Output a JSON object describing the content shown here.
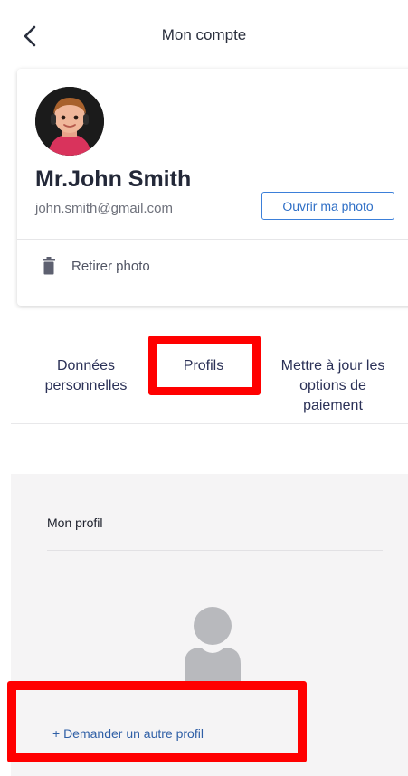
{
  "header": {
    "title": "Mon compte",
    "back_icon": "chevron-left-icon"
  },
  "account_card": {
    "name": "Mr.John Smith",
    "email": "john.smith@gmail.com",
    "open_photo_label": "Ouvrir ma photo",
    "remove_photo_label": "Retirer photo",
    "remove_icon": "trash-icon"
  },
  "tabs": {
    "personal_data": "Données personnelles",
    "profiles": "Profils",
    "payment_options": "Mettre à jour les options de paiement",
    "highlighted": "Profils"
  },
  "profile_panel": {
    "title": "Mon profil",
    "placeholder_icon": "user-placeholder-icon",
    "request_link": "+ Demander un autre profil"
  },
  "colors": {
    "accent": "#2f6fc6",
    "tab_text": "#2b3157",
    "highlight": "#ff0000",
    "panel_bg": "#f5f4f5"
  }
}
